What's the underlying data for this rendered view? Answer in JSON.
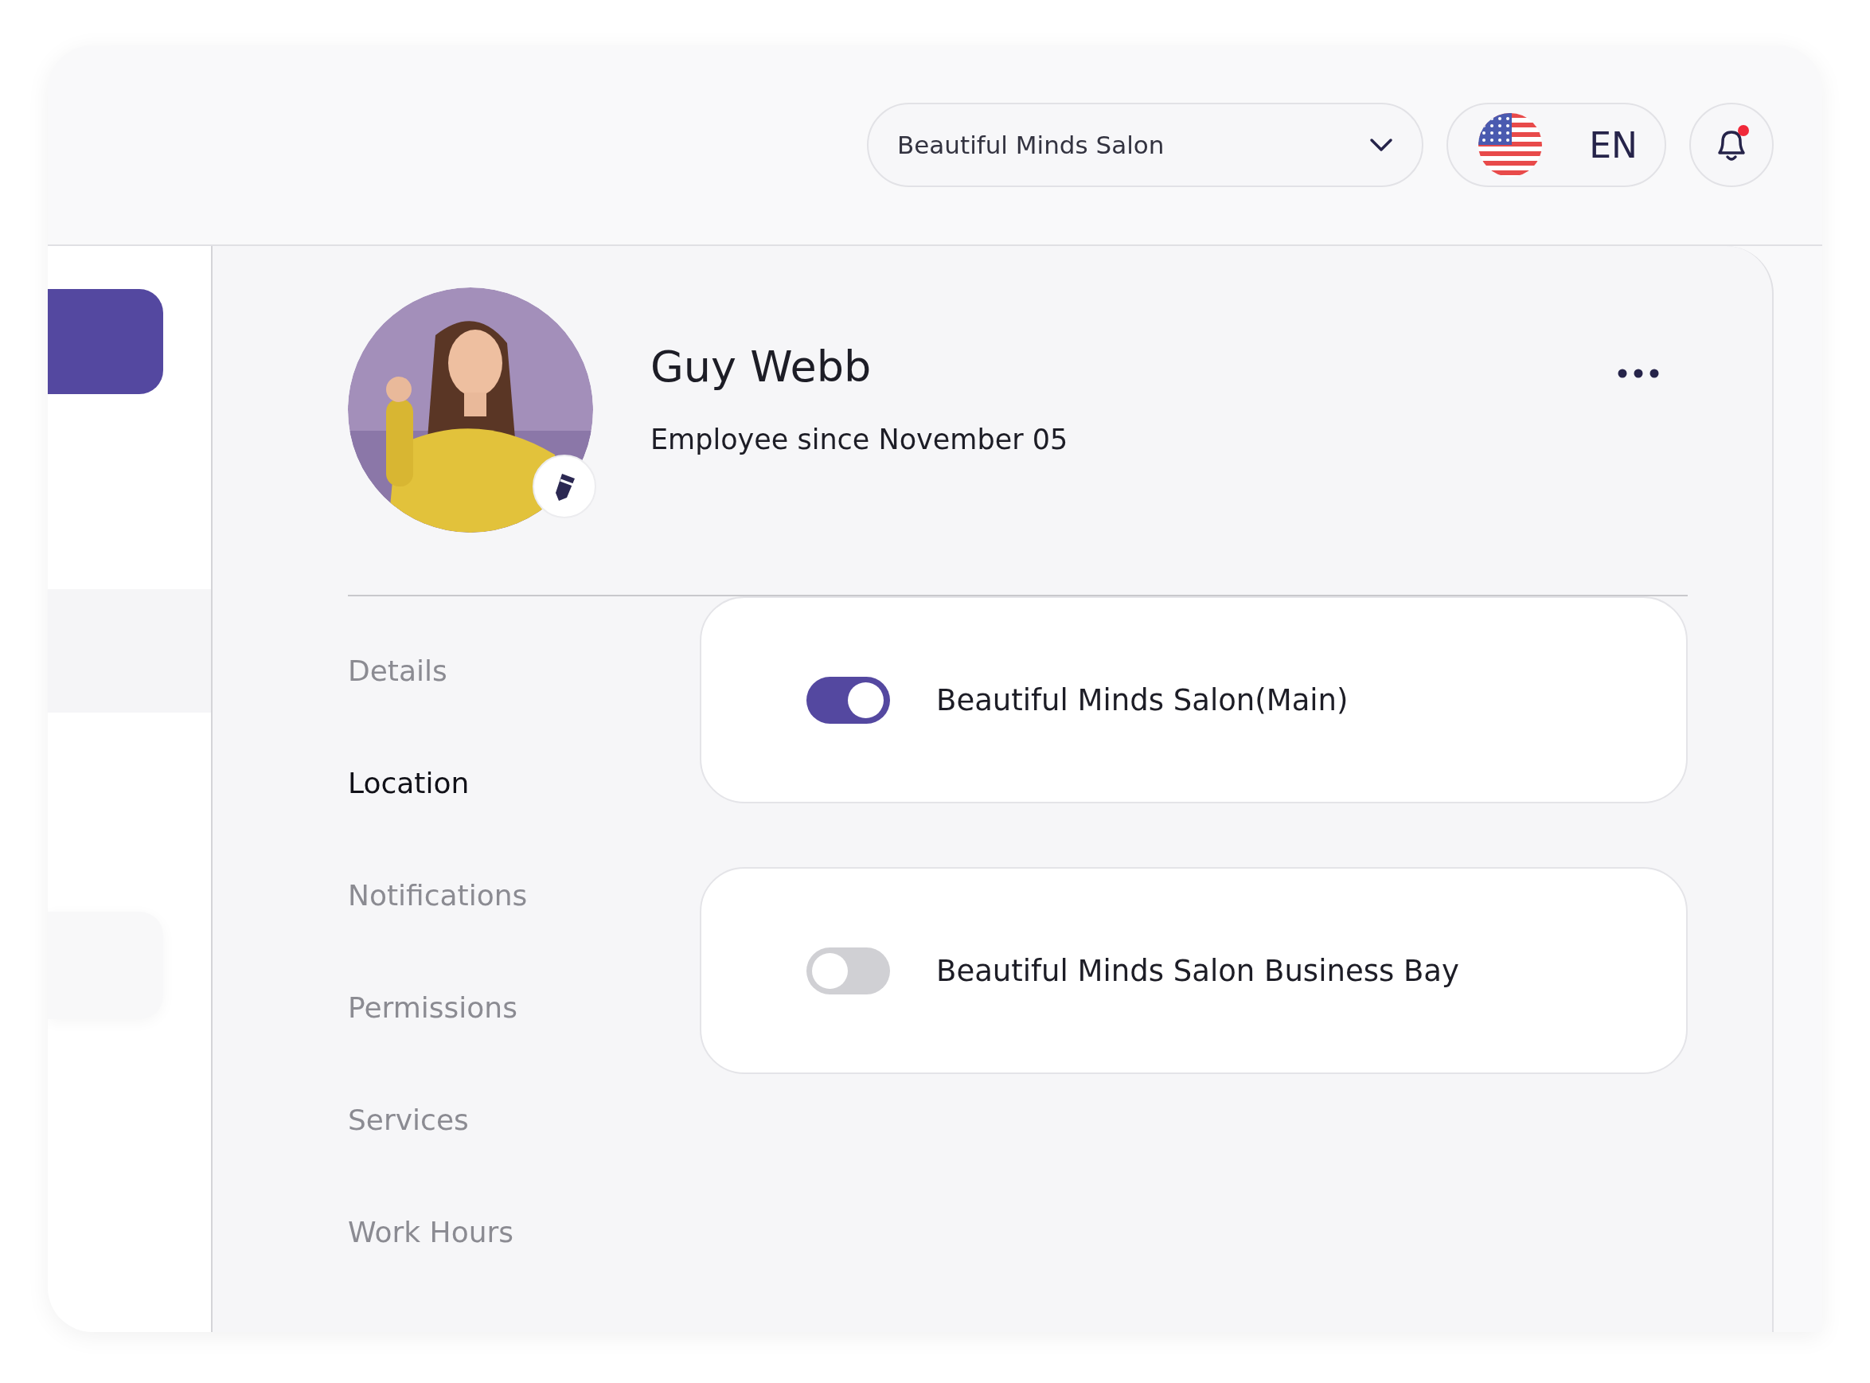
{
  "header": {
    "salon_select": {
      "value": "Beautiful Minds Salon"
    },
    "language": {
      "label": "EN"
    },
    "notifications": {
      "unread": true
    }
  },
  "sidebar": {
    "items": [
      {
        "kind": "active"
      },
      {
        "kind": "band"
      },
      {
        "kind": "card"
      }
    ]
  },
  "profile": {
    "name": "Guy Webb",
    "subtitle": "Employee since November 05"
  },
  "tabs": [
    {
      "label": "Details",
      "selected": false
    },
    {
      "label": "Location",
      "selected": true
    },
    {
      "label": "Notifications",
      "selected": false
    },
    {
      "label": "Permissions",
      "selected": false
    },
    {
      "label": "Services",
      "selected": false
    },
    {
      "label": "Work Hours",
      "selected": false
    }
  ],
  "locations": [
    {
      "name": "Beautiful Minds Salon(Main)",
      "on": true
    },
    {
      "name": "Beautiful Minds Salon Business Bay",
      "on": false
    }
  ]
}
